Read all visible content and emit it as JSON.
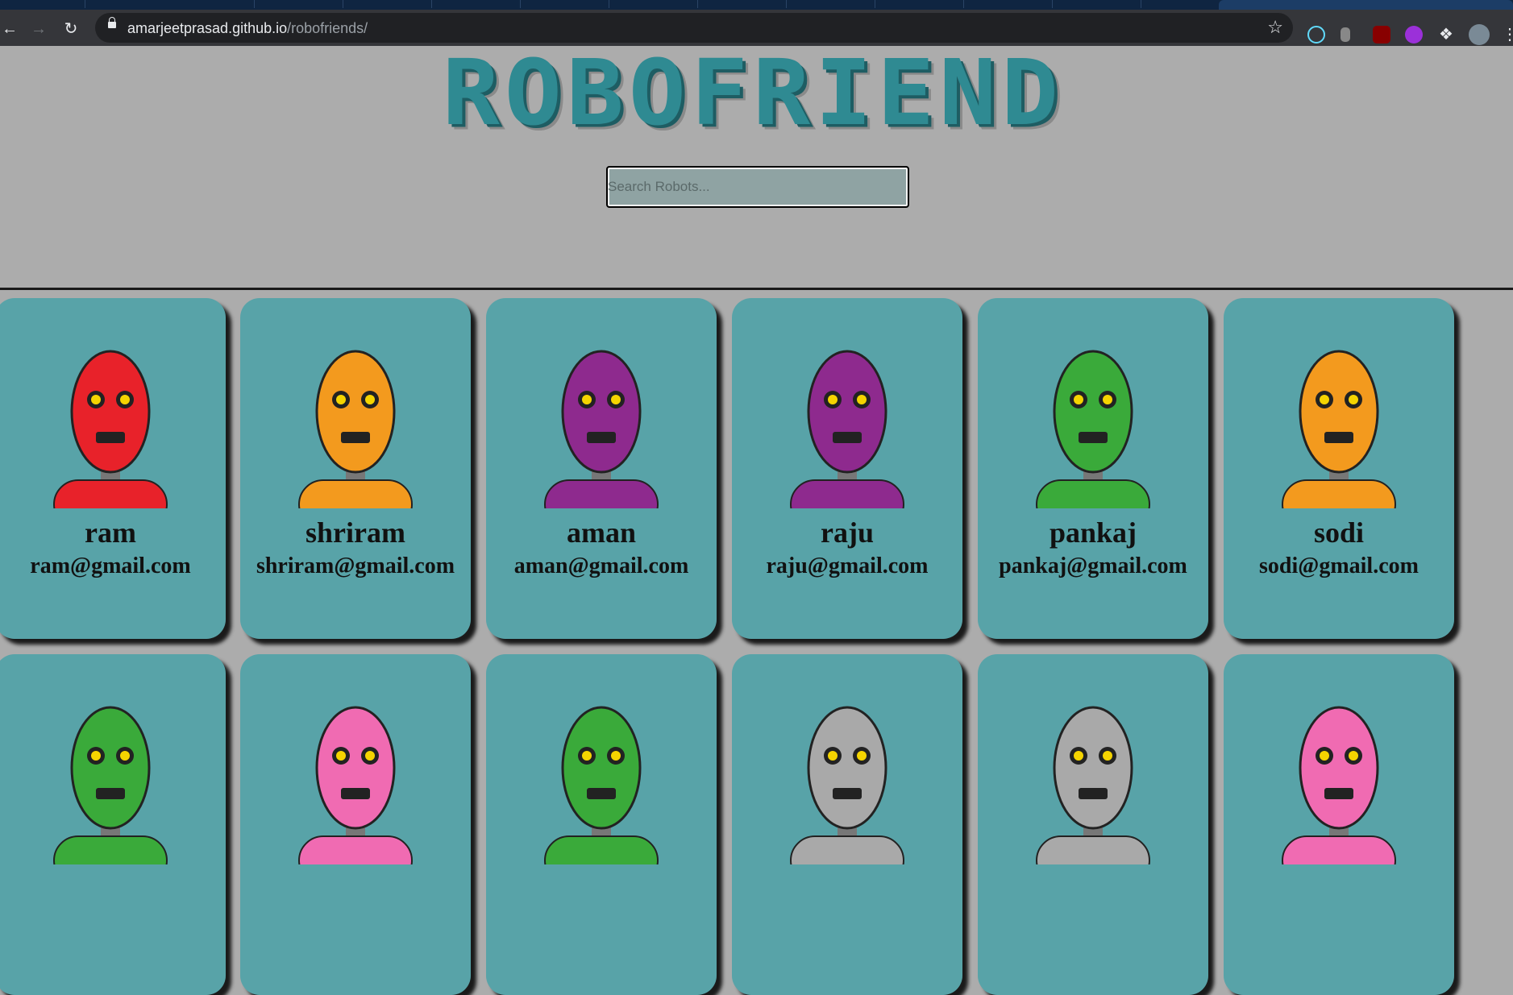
{
  "browser": {
    "url_host": "amarjeetprasad.github.io",
    "url_path": "/robofriends/"
  },
  "page": {
    "title": "ROBOFRIEND",
    "search_placeholder": "Search Robots..."
  },
  "robots": [
    {
      "name": "ram",
      "email": "ram@gmail.com",
      "color": "#e8222a"
    },
    {
      "name": "shriram",
      "email": "shriram@gmail.com",
      "color": "#f39a1e"
    },
    {
      "name": "aman",
      "email": "aman@gmail.com",
      "color": "#8e2a8e"
    },
    {
      "name": "raju",
      "email": "raju@gmail.com",
      "color": "#8e2a8e"
    },
    {
      "name": "pankaj",
      "email": "pankaj@gmail.com",
      "color": "#3aaa3a"
    },
    {
      "name": "sodi",
      "email": "sodi@gmail.com",
      "color": "#f39a1e"
    },
    {
      "name": "",
      "email": "",
      "color": "#3aaa3a"
    },
    {
      "name": "",
      "email": "",
      "color": "#f06bb2"
    },
    {
      "name": "",
      "email": "",
      "color": "#3aaa3a"
    },
    {
      "name": "",
      "email": "",
      "color": "#a9a9a9"
    },
    {
      "name": "",
      "email": "",
      "color": "#a9a9a9"
    },
    {
      "name": "",
      "email": "",
      "color": "#f06bb2"
    }
  ]
}
